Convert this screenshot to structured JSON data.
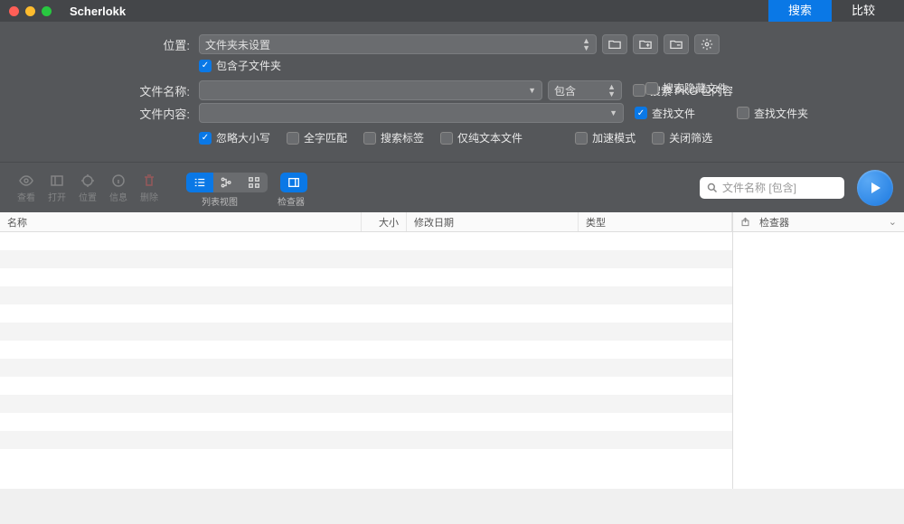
{
  "app_title": "Scherlokk",
  "tabs": {
    "search": "搜索",
    "compare": "比较"
  },
  "labels": {
    "location": "位置:",
    "filename": "文件名称:",
    "content": "文件内容:"
  },
  "location_combo": "文件夹未设置",
  "filename_mode": "包含",
  "checkboxes": {
    "include_subfolders": "包含子文件夹",
    "ignore_case": "忽略大小写",
    "whole_word": "全字匹配",
    "search_tags": "搜索标签",
    "text_only": "仅纯文本文件",
    "search_pkg": "搜索 PKG 包内容",
    "search_hidden": "搜索隐藏文件",
    "find_files": "查找文件",
    "find_folders": "查找文件夹",
    "fast_mode": "加速模式",
    "close_filter": "关闭筛选"
  },
  "toolbar": {
    "view": "查看",
    "open": "打开",
    "location": "位置",
    "info": "信息",
    "delete": "删除",
    "list_view": "列表视图",
    "inspector": "检查器"
  },
  "search_placeholder": "文件名称 [包含]",
  "columns": {
    "name": "名称",
    "size": "大小",
    "modified": "修改日期",
    "type": "类型"
  },
  "inspector_title": "检查器"
}
